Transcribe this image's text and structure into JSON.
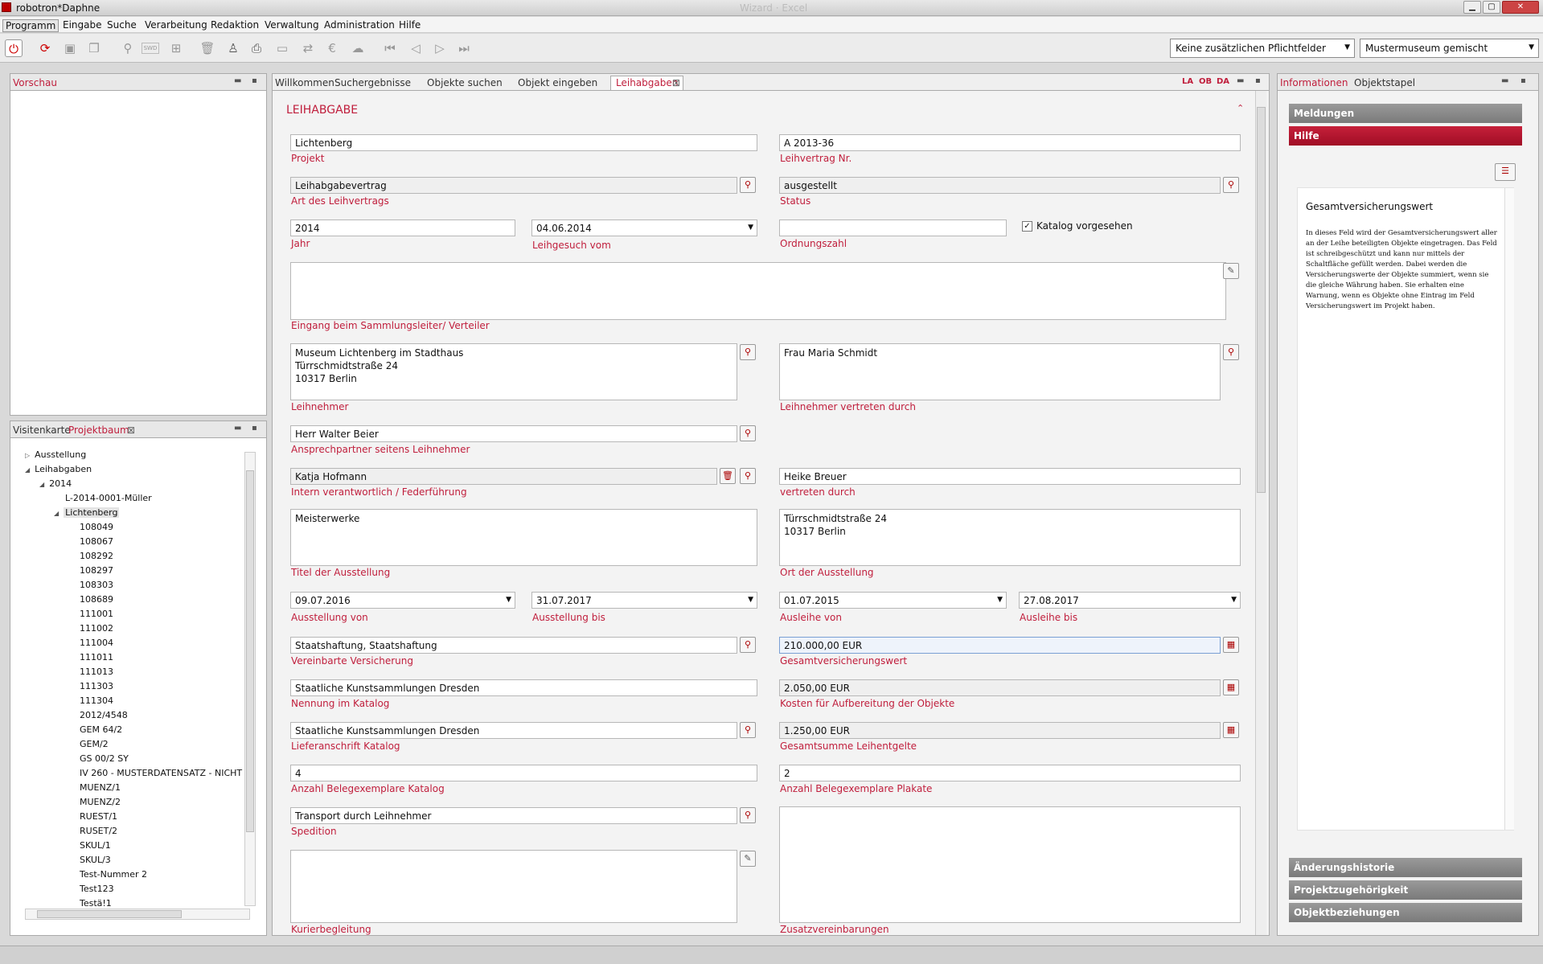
{
  "window": {
    "title": "robotron*Daphne",
    "ghost_title": "Wizard · Excel"
  },
  "menu": [
    "Programm",
    "Eingabe",
    "Suche",
    "Verarbeitung",
    "Redaktion",
    "Verwaltung",
    "Administration",
    "Hilfe"
  ],
  "toolbar": {
    "combo1": "Keine zusätzlichen Pflichtfelder",
    "combo2": "Mustermuseum gemischt",
    "swd_label": "SWD"
  },
  "left_top": {
    "tab": "Vorschau"
  },
  "left_bottom": {
    "tabs": [
      "Visitenkarte",
      "Projektbaum"
    ],
    "tree": [
      {
        "label": "Ausstellung",
        "level": 0,
        "arrow": "▷"
      },
      {
        "label": "Leihabgaben",
        "level": 0,
        "arrow": "◢"
      },
      {
        "label": "2014",
        "level": 1,
        "arrow": "◢"
      },
      {
        "label": "L-2014-0001-Müller",
        "level": 2,
        "arrow": ""
      },
      {
        "label": "Lichtenberg",
        "level": 2,
        "arrow": "◢"
      },
      {
        "label": "108049",
        "level": 3,
        "arrow": ""
      },
      {
        "label": "108067",
        "level": 3,
        "arrow": ""
      },
      {
        "label": "108292",
        "level": 3,
        "arrow": ""
      },
      {
        "label": "108297",
        "level": 3,
        "arrow": ""
      },
      {
        "label": "108303",
        "level": 3,
        "arrow": ""
      },
      {
        "label": "108689",
        "level": 3,
        "arrow": ""
      },
      {
        "label": "111001",
        "level": 3,
        "arrow": ""
      },
      {
        "label": "111002",
        "level": 3,
        "arrow": ""
      },
      {
        "label": "111004",
        "level": 3,
        "arrow": ""
      },
      {
        "label": "111011",
        "level": 3,
        "arrow": ""
      },
      {
        "label": "111013",
        "level": 3,
        "arrow": ""
      },
      {
        "label": "111303",
        "level": 3,
        "arrow": ""
      },
      {
        "label": "111304",
        "level": 3,
        "arrow": ""
      },
      {
        "label": "2012/4548",
        "level": 3,
        "arrow": ""
      },
      {
        "label": "GEM 64/2",
        "level": 3,
        "arrow": ""
      },
      {
        "label": "GEM/2",
        "level": 3,
        "arrow": ""
      },
      {
        "label": "GS 00/2 SY",
        "level": 3,
        "arrow": ""
      },
      {
        "label": "IV 260 - MUSTERDATENSATZ - NICHT",
        "level": 3,
        "arrow": ""
      },
      {
        "label": "MUENZ/1",
        "level": 3,
        "arrow": ""
      },
      {
        "label": "MUENZ/2",
        "level": 3,
        "arrow": ""
      },
      {
        "label": "RUEST/1",
        "level": 3,
        "arrow": ""
      },
      {
        "label": "RUSET/2",
        "level": 3,
        "arrow": ""
      },
      {
        "label": "SKUL/1",
        "level": 3,
        "arrow": ""
      },
      {
        "label": "SKUL/3",
        "level": 3,
        "arrow": ""
      },
      {
        "label": "Test-Nummer 2",
        "level": 3,
        "arrow": ""
      },
      {
        "label": "Test123",
        "level": 3,
        "arrow": ""
      },
      {
        "label": "Testä!1",
        "level": 3,
        "arrow": ""
      }
    ]
  },
  "center": {
    "tabs": [
      "Willkommen",
      "Suchergebnisse",
      "Objekte suchen",
      "Objekt eingeben",
      "Leihabgaben"
    ],
    "lang": [
      "LA",
      "OB",
      "DA"
    ],
    "section_title": "LEIHABGABE",
    "fields": {
      "projekt": {
        "label": "Projekt",
        "value": "Lichtenberg"
      },
      "leihvertrag_nr": {
        "label": "Leihvertrag Nr.",
        "value": "A 2013-36"
      },
      "art": {
        "label": "Art des Leihvertrags",
        "value": "Leihabgabevertrag"
      },
      "status": {
        "label": "Status",
        "value": "ausgestellt"
      },
      "jahr": {
        "label": "Jahr",
        "value": "2014"
      },
      "leihgesuch": {
        "label": "Leihgesuch vom",
        "value": "04.06.2014"
      },
      "ordnungszahl": {
        "label": "Ordnungszahl",
        "value": ""
      },
      "katalog": {
        "label": "Katalog vorgesehen",
        "checked": "✓"
      },
      "eingang": {
        "label": "Eingang beim Sammlungsleiter/ Verteiler",
        "value": ""
      },
      "leihnehmer": {
        "label": "Leihnehmer",
        "lines": [
          "Museum Lichtenberg im Stadthaus",
          "Türrschmidtstraße 24",
          "10317 Berlin"
        ]
      },
      "leihnehmer_vertreten": {
        "label": "Leihnehmer vertreten durch",
        "lines": [
          "Frau Maria Schmidt"
        ]
      },
      "ansprechpartner": {
        "label": "Ansprechpartner seitens Leihnehmer",
        "value": "Herr Walter Beier"
      },
      "intern": {
        "label": "Intern verantwortlich / Federführung",
        "value": "Katja Hofmann"
      },
      "vertreten": {
        "label": "vertreten durch",
        "value": "Heike Breuer"
      },
      "titel": {
        "label": "Titel der Ausstellung",
        "lines": [
          "Meisterwerke"
        ]
      },
      "ort": {
        "label": "Ort der Ausstellung",
        "lines": [
          "Türrschmidtstraße 24",
          "10317 Berlin"
        ]
      },
      "ausstellung_von": {
        "label": "Ausstellung von",
        "value": "09.07.2016"
      },
      "ausstellung_bis": {
        "label": "Ausstellung bis",
        "value": "31.07.2017"
      },
      "ausleihe_von": {
        "label": "Ausleihe von",
        "value": "01.07.2015"
      },
      "ausleihe_bis": {
        "label": "Ausleihe bis",
        "value": "27.08.2017"
      },
      "versicherung": {
        "label": "Vereinbarte Versicherung",
        "value": "Staatshaftung, Staatshaftung"
      },
      "gesamtversicherung": {
        "label": "Gesamtversicherungswert",
        "value": "210.000,00 EUR"
      },
      "nennung": {
        "label": "Nennung im Katalog",
        "value": "Staatliche Kunstsammlungen Dresden"
      },
      "kosten": {
        "label": "Kosten für Aufbereitung der Objekte",
        "value": "2.050,00 EUR"
      },
      "lieferanschrift": {
        "label": "Lieferanschrift Katalog",
        "value": "Staatliche Kunstsammlungen Dresden"
      },
      "leihentgelte": {
        "label": "Gesamtsumme Leihentgelte",
        "value": "1.250,00 EUR"
      },
      "beleg_katalog": {
        "label": "Anzahl Belegexemplare Katalog",
        "value": "4"
      },
      "beleg_plakate": {
        "label": "Anzahl Belegexemplare Plakate",
        "value": "2"
      },
      "spedition": {
        "label": "Spedition",
        "value": "Transport durch Leihnehmer"
      },
      "kurier": {
        "label": "Kurierbegleitung"
      },
      "zusatz": {
        "label": "Zusatzvereinbarungen"
      }
    }
  },
  "right": {
    "tabs": [
      "Informationen",
      "Objektstapel"
    ],
    "sections": [
      "Meldungen",
      "Hilfe",
      "Änderungshistorie",
      "Projektzugehörigkeit",
      "Objektbeziehungen"
    ],
    "help_title": "Gesamtversicherungswert",
    "help_text": "In dieses Feld wird der Gesamtversicherungswert aller an der Leihe beteiligten Objekte eingetragen. Das Feld ist schreibgeschützt und kann nur mittels der Schaltfläche gefüllt werden. Dabei werden die Versicherungswerte der Objekte summiert, wenn sie die gleiche Währung haben. Sie erhalten eine Warnung, wenn es Objekte ohne Eintrag im Feld Versicherungswert im Projekt haben."
  },
  "colors": {
    "accent": "#c01e3c",
    "hilfe_bar": "#b3102a",
    "section_bar": "#8a8a8a"
  }
}
